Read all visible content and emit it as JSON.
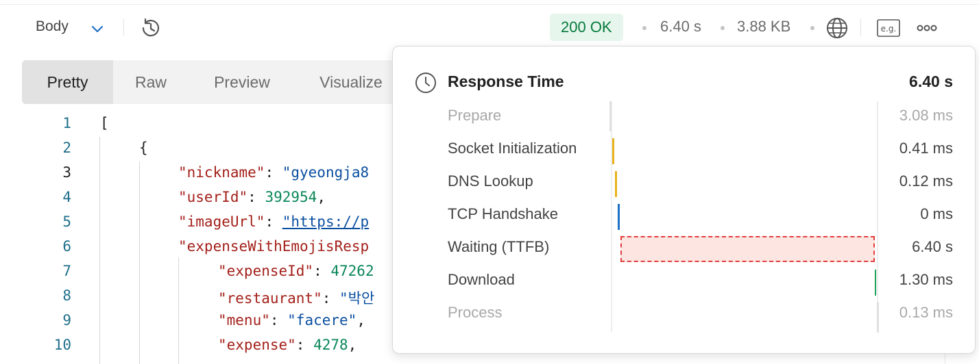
{
  "toolbar": {
    "body_label": "Body",
    "status": "200 OK",
    "time": "6.40 s",
    "size": "3.88 KB"
  },
  "tabs": [
    "Pretty",
    "Raw",
    "Preview",
    "Visualize"
  ],
  "editor": {
    "line_numbers": [
      "1",
      "2",
      "3",
      "4",
      "5",
      "6",
      "7",
      "8",
      "9",
      "10"
    ],
    "lines": [
      {
        "key": "",
        "value": "["
      },
      {
        "key": "",
        "value": "{"
      },
      {
        "key": "\"nickname\"",
        "value": "\"gyeongja8"
      },
      {
        "key": "\"userId\"",
        "value": "392954"
      },
      {
        "key": "\"imageUrl\"",
        "value": "\"https://p"
      },
      {
        "key": "\"expenseWithEmojisResp",
        "value": ""
      },
      {
        "key": "\"expenseId\"",
        "value": "47262"
      },
      {
        "key": "\"restaurant\"",
        "value": "\"박안"
      },
      {
        "key": "\"menu\"",
        "value": "\"facere\""
      },
      {
        "key": "\"expense\"",
        "value": "4278"
      }
    ]
  },
  "timing": {
    "title": "Response Time",
    "total": "6.40 s",
    "rows": [
      {
        "label": "Prepare",
        "value": "3.08 ms",
        "color": "#e0e0e0",
        "dim": true
      },
      {
        "label": "Socket Initialization",
        "value": "0.41 ms",
        "color": "#e8b21a",
        "dim": false
      },
      {
        "label": "DNS Lookup",
        "value": "0.12 ms",
        "color": "#e8b21a",
        "dim": false
      },
      {
        "label": "TCP Handshake",
        "value": "0 ms",
        "color": "#1c6fc4",
        "dim": false
      },
      {
        "label": "Waiting (TTFB)",
        "value": "6.40 s",
        "color": "#e03a3a",
        "dim": false
      },
      {
        "label": "Download",
        "value": "1.30 ms",
        "color": "#1fa35a",
        "dim": false
      },
      {
        "label": "Process",
        "value": "0.13 ms",
        "color": "#e0e0e0",
        "dim": true
      }
    ]
  }
}
